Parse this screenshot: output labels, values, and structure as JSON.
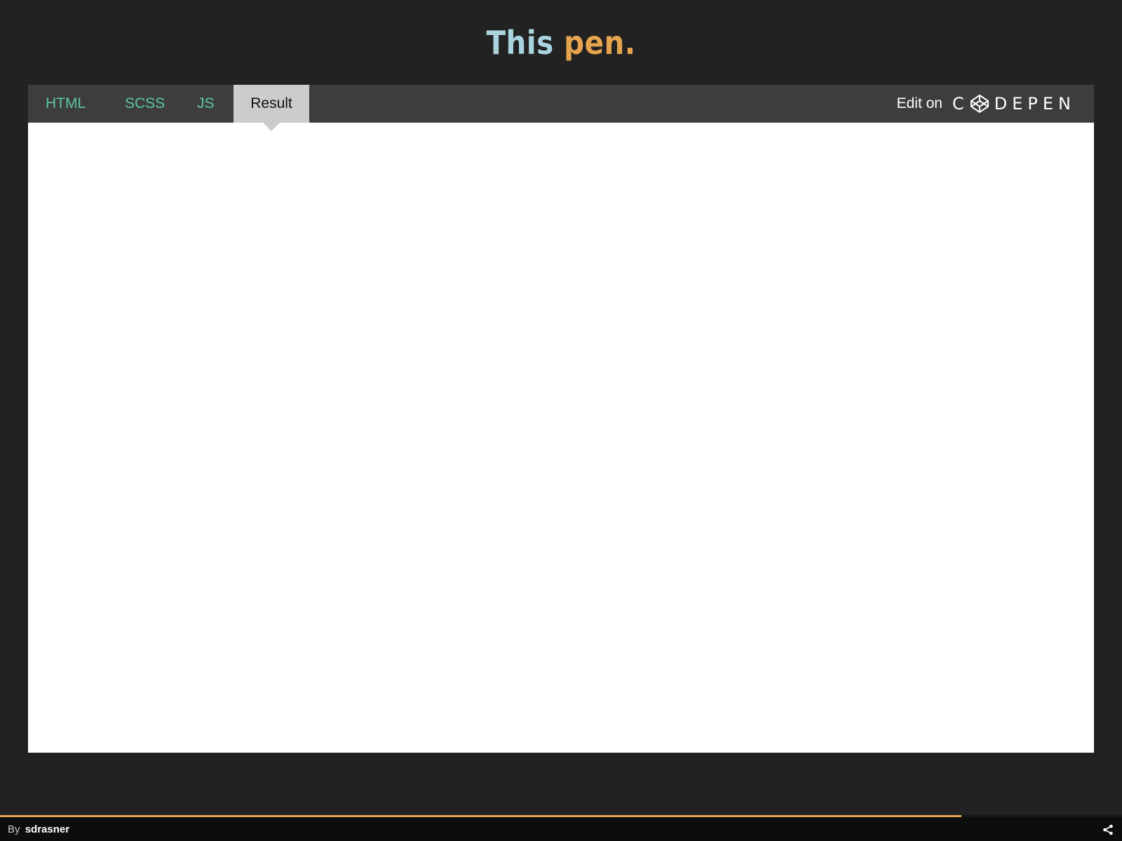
{
  "title": {
    "part1": "This",
    "part2": "pen."
  },
  "tabs": {
    "html": "HTML",
    "scss": "SCSS",
    "js": "JS",
    "result": "Result",
    "active": "Result"
  },
  "edit_on": {
    "label": "Edit on",
    "brand": "CODEPEN"
  },
  "footer": {
    "by_label": "By",
    "author": "sdrasner",
    "progress": 0.857
  },
  "colors": {
    "background": "#222222",
    "title_primary": "#a9d4df",
    "title_accent": "#e6a44f",
    "tab_text": "#5cc6a8",
    "active_tab_bg": "#cccccc",
    "tabbar_bg": "#3d3d3d",
    "progress": "#e6a44f"
  },
  "icons": {
    "share": "share-icon",
    "codepen": "codepen-logo-icon"
  }
}
